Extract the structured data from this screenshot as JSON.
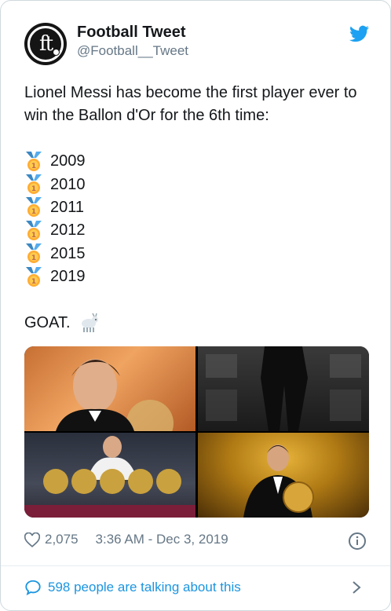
{
  "tweet": {
    "display_name": "Football Tweet",
    "handle": "@Football__Tweet",
    "avatar_text": "ft",
    "text": "Lionel Messi has become the first player ever to win the Ballon d'Or for the 6th time:",
    "years": [
      "2009",
      "2010",
      "2011",
      "2012",
      "2015",
      "2019"
    ],
    "closing": "GOAT."
  },
  "meta": {
    "likes": "2,075",
    "timestamp": "3:36 AM - Dec 3, 2019"
  },
  "conversation": {
    "label": "598 people are talking about this"
  },
  "colors": {
    "twitter_blue": "#1da1f2",
    "link_blue": "#1b95e0",
    "muted": "#657786"
  },
  "icons": [
    "twitter-bird-icon",
    "medal-icon",
    "goat-icon",
    "heart-icon",
    "info-icon",
    "speech-bubble-icon",
    "chevron-right-icon"
  ]
}
